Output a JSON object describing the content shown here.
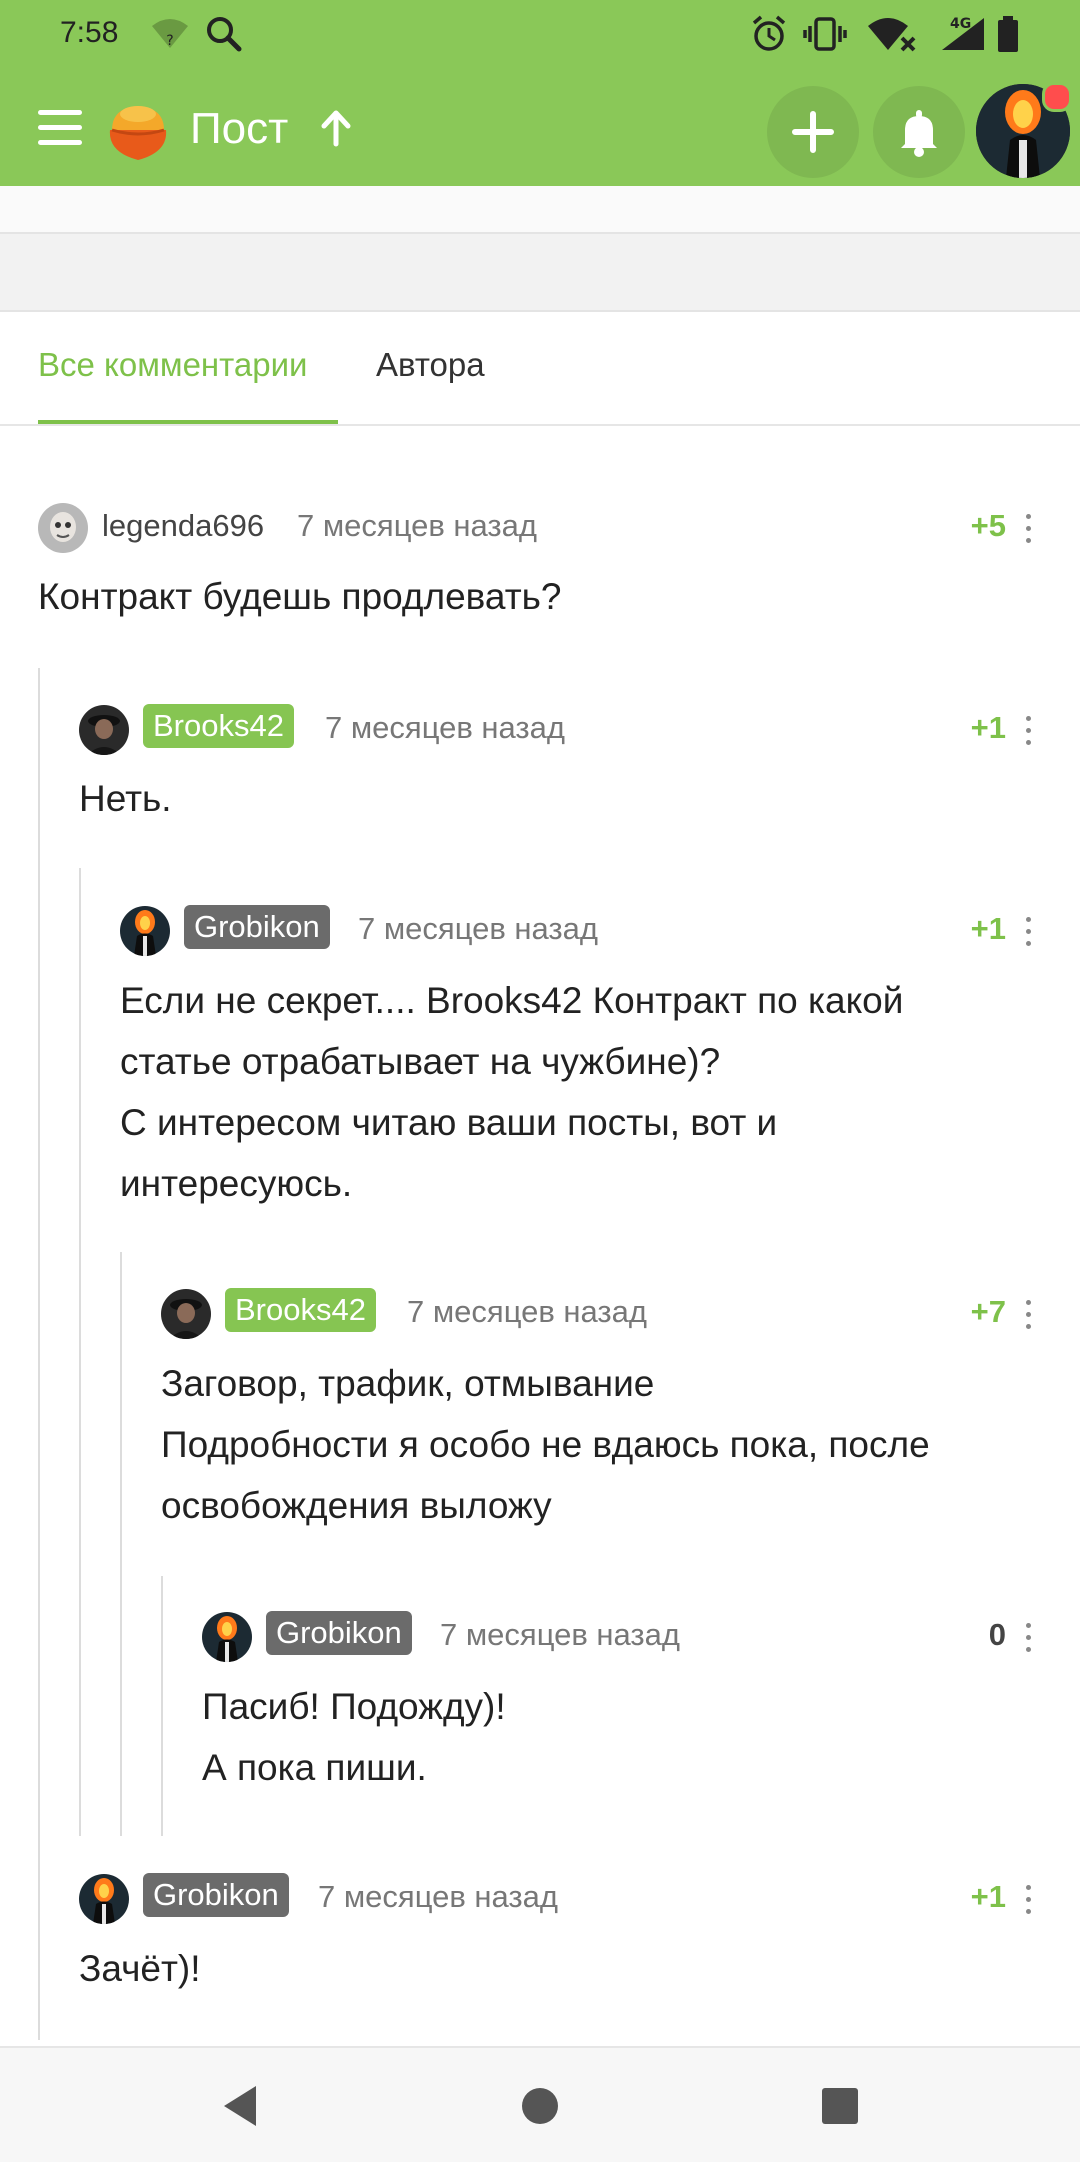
{
  "status_bar": {
    "time": "7:58",
    "icons": [
      "wifi-unknown-icon",
      "search-icon",
      "alarm-icon",
      "vibrate-icon",
      "wifi-x-icon",
      "signal-4g-icon",
      "battery-icon"
    ],
    "network": "4G"
  },
  "app_bar": {
    "title": "Пост",
    "icons": [
      "menu-icon",
      "pikabu-logo",
      "arrow-up-icon",
      "plus-icon",
      "bell-icon",
      "user-avatar"
    ],
    "accent": "#8ac858"
  },
  "tabs": [
    {
      "label": "Все комментарии",
      "active": true
    },
    {
      "label": "Автора",
      "active": false
    }
  ],
  "comments": [
    {
      "author": "legenda696",
      "badge": "none",
      "time": "7 месяцев назад",
      "rating": "+5",
      "lines": [
        "Контракт будешь продлевать?"
      ]
    },
    {
      "author": "Brooks42",
      "badge": "green",
      "time": "7 месяцев назад",
      "rating": "+1",
      "lines": [
        "Неть."
      ]
    },
    {
      "author": "Grobikon",
      "badge": "gray",
      "time": "7 месяцев назад",
      "rating": "+1",
      "lines": [
        "Если не секрет.... Brooks42 Контракт по какой",
        "статье отрабатывает на чужбине)?",
        "С интересом читаю ваши посты, вот и",
        "интересуюсь."
      ]
    },
    {
      "author": "Brooks42",
      "badge": "green",
      "time": "7 месяцев назад",
      "rating": "+7",
      "lines": [
        "Заговор, трафик, отмывание",
        "Подробности я особо не вдаюсь пока, после",
        "освобождения выложу"
      ]
    },
    {
      "author": "Grobikon",
      "badge": "gray",
      "time": "7 месяцев назад",
      "rating": "0",
      "lines": [
        "Пасиб! Подожду)!",
        "А пока пиши."
      ]
    },
    {
      "author": "Grobikon",
      "badge": "gray",
      "time": "7 месяцев назад",
      "rating": "+1",
      "lines": [
        "Зачёт)!"
      ]
    }
  ],
  "colors": {
    "green": "#86c552",
    "gray_badge": "#6b6b6b",
    "rating_green": "#7ec14a"
  },
  "nav_bar": {
    "icons": [
      "back-icon",
      "home-icon",
      "recents-icon"
    ]
  }
}
